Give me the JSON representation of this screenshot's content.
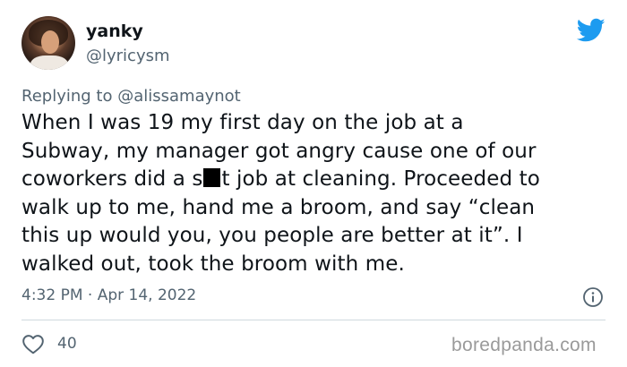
{
  "author": {
    "display_name": "yanky",
    "handle": "@lyricysm"
  },
  "reply": {
    "prefix": "Replying to",
    "mention": "@alissamaynot"
  },
  "tweet": {
    "lines": [
      "When I was 19 my first day on the job at a",
      "Subway, my manager got angry cause one of our",
      "coworkers did a s",
      "t job at cleaning. Proceeded to",
      "walk up to me, hand me a broom, and say “clean",
      "this up would you, you people are better at it”. I",
      "walked out, took the broom with me."
    ],
    "timestamp": "4:32 PM · Apr 14, 2022"
  },
  "actions": {
    "like_count": "40"
  },
  "watermark": "boredpanda.com",
  "colors": {
    "twitter_blue": "#1d9bf0",
    "secondary_text": "#536471",
    "primary_text": "#0f1419"
  },
  "icons": {
    "brand": "twitter-bird-icon",
    "info": "info-icon",
    "like": "heart-icon"
  }
}
